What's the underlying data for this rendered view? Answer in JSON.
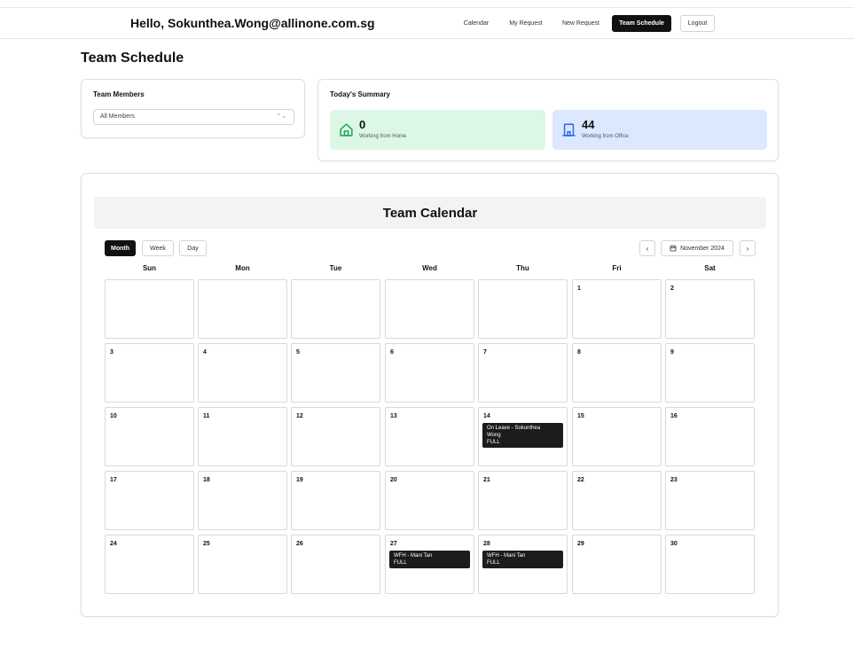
{
  "header": {
    "greeting": "Hello, Sokunthea.Wong@allinone.com.sg",
    "nav": [
      "Calendar",
      "My Request",
      "New Request",
      "Team Schedule",
      "Logout"
    ],
    "active_nav": "Team Schedule"
  },
  "page": {
    "title": "Team Schedule"
  },
  "team_members": {
    "title": "Team Members",
    "selected": "All Members"
  },
  "summary": {
    "title": "Today's Summary",
    "home": {
      "value": "0",
      "label": "Working from Home"
    },
    "office": {
      "value": "44",
      "label": "Working from Office"
    }
  },
  "calendar": {
    "title": "Team Calendar",
    "views": [
      "Month",
      "Week",
      "Day"
    ],
    "active_view": "Month",
    "month_label": "November 2024",
    "prev": "‹",
    "next": "›",
    "weekdays": [
      "Sun",
      "Mon",
      "Tue",
      "Wed",
      "Thu",
      "Fri",
      "Sat"
    ],
    "weeks": [
      [
        "",
        "",
        "",
        "",
        "",
        "1",
        "2"
      ],
      [
        "3",
        "4",
        "5",
        "6",
        "7",
        "8",
        "9"
      ],
      [
        "10",
        "11",
        "12",
        "13",
        "14",
        "15",
        "16"
      ],
      [
        "17",
        "18",
        "19",
        "20",
        "21",
        "22",
        "23"
      ],
      [
        "24",
        "25",
        "26",
        "27",
        "28",
        "29",
        "30"
      ]
    ],
    "events": [
      {
        "day": "14",
        "lines": [
          "On Leave - Sokunthea",
          "Wong",
          "FULL"
        ]
      },
      {
        "day": "27",
        "lines": [
          "WFH - Mani Tan",
          "FULL"
        ]
      },
      {
        "day": "28",
        "lines": [
          "WFH - Mani Tan",
          "FULL"
        ]
      }
    ]
  },
  "colors": {
    "home_bg": "#dcf7e6",
    "office_bg": "#dbe8fd",
    "home_icon": "#16a34a",
    "office_icon": "#2563eb",
    "dark": "#111111"
  }
}
